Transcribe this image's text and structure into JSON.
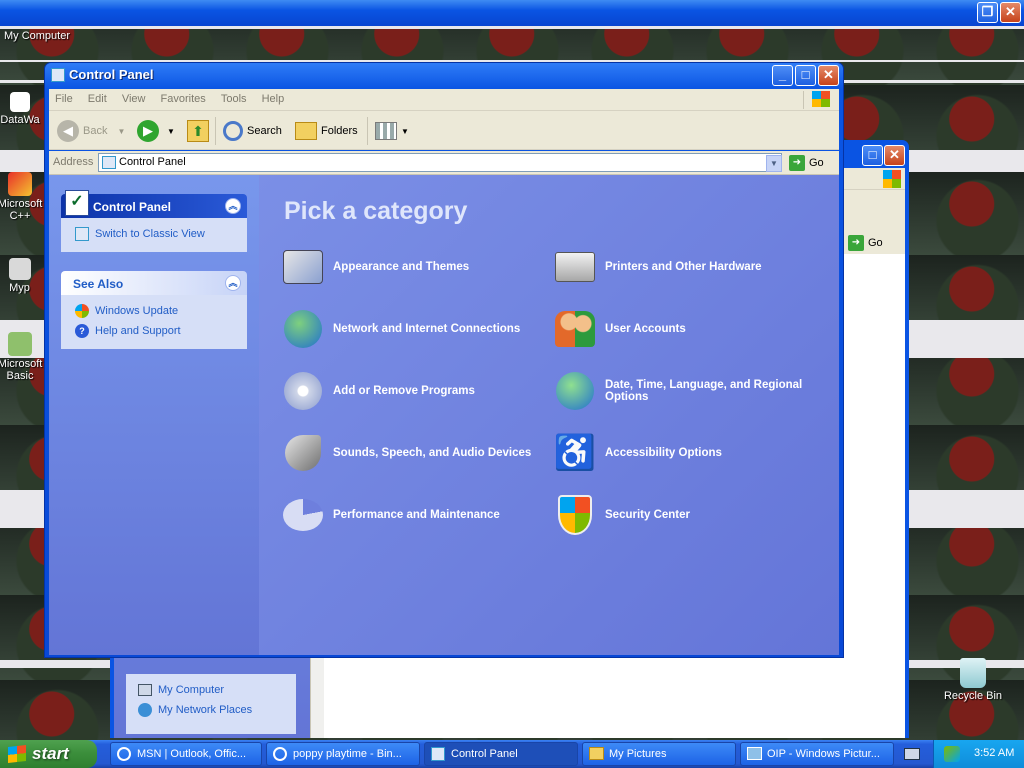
{
  "desktop": {
    "icons": [
      {
        "label": "My Computer"
      },
      {
        "label": "DataWa"
      },
      {
        "label": "Microsoft C++"
      },
      {
        "label": "Myp"
      },
      {
        "label": "Microsoft Basic"
      },
      {
        "label": "Recycle Bin"
      }
    ]
  },
  "window": {
    "title": "Control Panel",
    "menu": [
      "File",
      "Edit",
      "View",
      "Favorites",
      "Tools",
      "Help"
    ],
    "toolbar": {
      "back": "Back",
      "search": "Search",
      "folders": "Folders"
    },
    "address": {
      "label": "Address",
      "value": "Control Panel",
      "go": "Go"
    }
  },
  "sidebar": {
    "control_panel": {
      "header": "Control Panel",
      "items": [
        "Switch to Classic View"
      ]
    },
    "see_also": {
      "header": "See Also",
      "items": [
        "Windows Update",
        "Help and Support"
      ]
    }
  },
  "main": {
    "heading": "Pick a category",
    "categories": [
      "Appearance and Themes",
      "Printers and Other Hardware",
      "Network and Internet Connections",
      "User Accounts",
      "Add or Remove Programs",
      "Date, Time, Language, and Regional Options",
      "Sounds, Speech, and Audio Devices",
      "Accessibility Options",
      "Performance and Maintenance",
      "Security Center"
    ]
  },
  "background_window": {
    "go": "Go",
    "other_places": [
      "My Computer",
      "My Network Places"
    ]
  },
  "taskbar": {
    "start": "start",
    "buttons": [
      "MSN | Outlook, Offic...",
      "poppy playtime - Bin...",
      "Control Panel",
      "My Pictures",
      "OIP - Windows Pictur..."
    ],
    "clock": "3:52 AM"
  }
}
